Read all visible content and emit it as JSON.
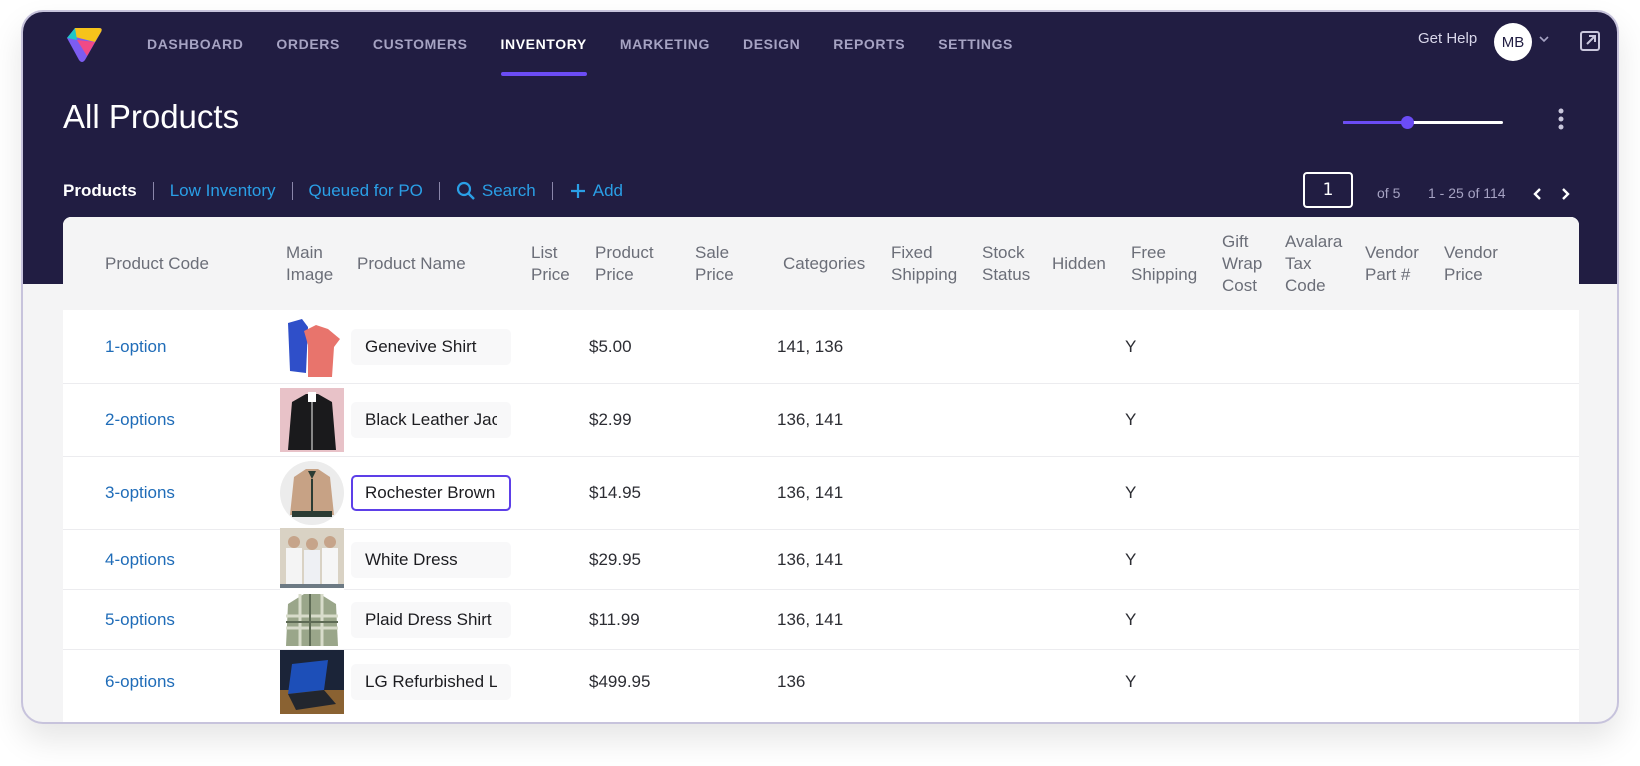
{
  "nav": {
    "items": [
      {
        "label": "DASHBOARD",
        "active": false
      },
      {
        "label": "ORDERS",
        "active": false
      },
      {
        "label": "CUSTOMERS",
        "active": false
      },
      {
        "label": "INVENTORY",
        "active": true
      },
      {
        "label": "MARKETING",
        "active": false
      },
      {
        "label": "DESIGN",
        "active": false
      },
      {
        "label": "REPORTS",
        "active": false
      },
      {
        "label": "SETTINGS",
        "active": false
      }
    ],
    "help_label": "Get Help",
    "avatar_initials": "MB"
  },
  "page": {
    "title": "All Products",
    "zoom_slider_value": 0.4
  },
  "subnav": {
    "products": "Products",
    "low_inventory": "Low Inventory",
    "queued_for_po": "Queued for PO",
    "search": "Search",
    "add": "Add"
  },
  "pagination": {
    "current_page": "1",
    "of_pages": "of 5",
    "range": "1 - 25 of 114"
  },
  "colors": {
    "header_bg": "#211d42",
    "accent": "#6b4cf5",
    "link": "#2a9fe6",
    "code_link": "#1f6cb8"
  },
  "table": {
    "columns": [
      "Product Code",
      "Main Image",
      "Product Name",
      "List Price",
      "Product Price",
      "Sale Price",
      "Categories",
      "Fixed Shipping",
      "Stock Status",
      "Hidden",
      "Free Shipping",
      "Gift Wrap Cost",
      "Avalara Tax Code",
      "Vendor Part #",
      "Vendor Price"
    ],
    "rows": [
      {
        "code": "1-option",
        "image": "shirts-image",
        "name": "Genevive Shirt",
        "list_price": "",
        "product_price": "$5.00",
        "sale_price": "",
        "categories": "141, 136",
        "free_shipping": "Y",
        "focused": false
      },
      {
        "code": "2-options",
        "image": "black-jacket-image",
        "name": "Black Leather Jacket",
        "list_price": "",
        "product_price": "$2.99",
        "sale_price": "",
        "categories": "136, 141",
        "free_shipping": "Y",
        "focused": false
      },
      {
        "code": "3-options",
        "image": "brown-jacket-image",
        "name": "Rochester Brown",
        "list_price": "",
        "product_price": "$14.95",
        "sale_price": "",
        "categories": "136, 141",
        "free_shipping": "Y",
        "focused": true
      },
      {
        "code": "4-options",
        "image": "white-dress-image",
        "name": "White Dress",
        "list_price": "",
        "product_price": "$29.95",
        "sale_price": "",
        "categories": "136, 141",
        "free_shipping": "Y",
        "focused": false
      },
      {
        "code": "5-options",
        "image": "plaid-shirt-image",
        "name": "Plaid Dress Shirt",
        "list_price": "",
        "product_price": "$11.99",
        "sale_price": "",
        "categories": "136, 141",
        "free_shipping": "Y",
        "focused": false
      },
      {
        "code": "6-options",
        "image": "laptop-image",
        "name": "LG Refurbished L",
        "list_price": "",
        "product_price": "$499.95",
        "sale_price": "",
        "categories": "136",
        "free_shipping": "Y",
        "focused": false
      }
    ]
  }
}
